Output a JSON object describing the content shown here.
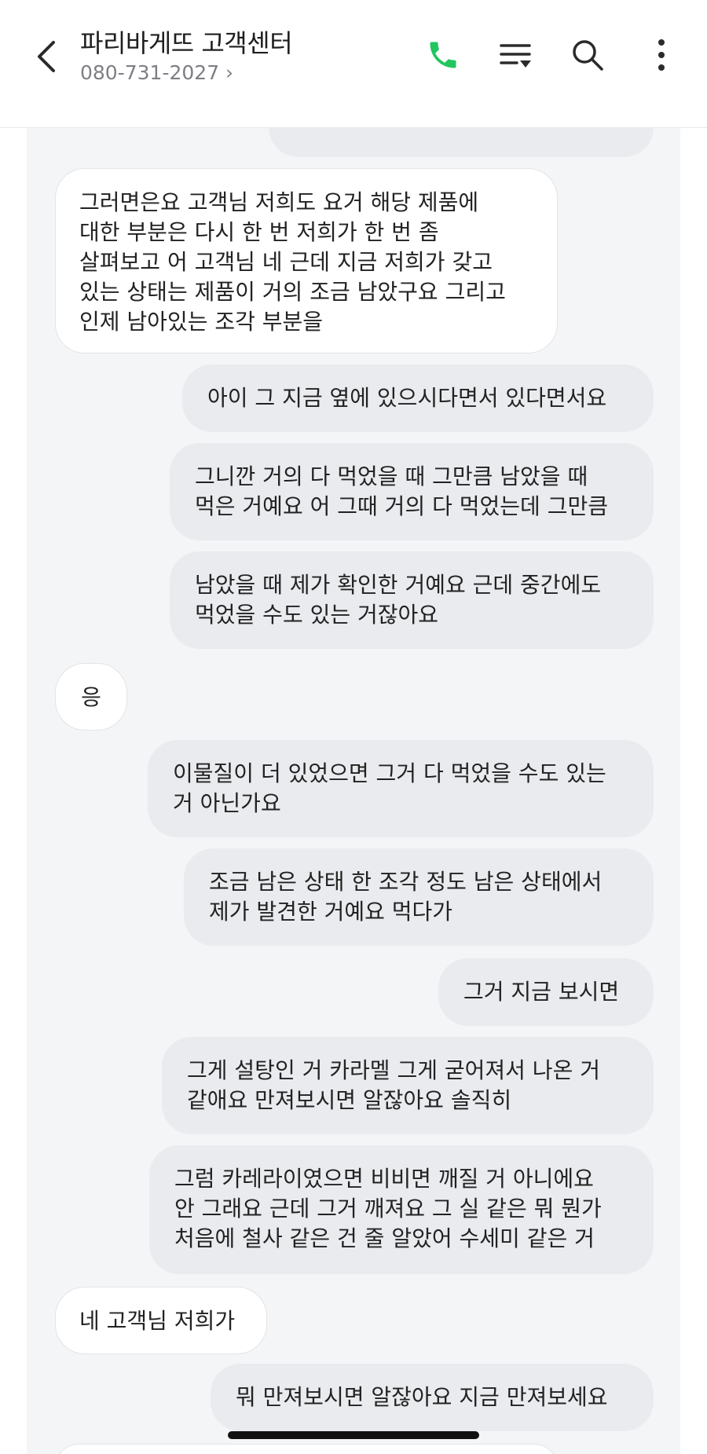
{
  "header": {
    "title": "파리바게뜨 고객센터",
    "phone": "080-731-2027 ›",
    "colors": {
      "call": "#22c55e",
      "text": "#1f1f1f",
      "sub": "#7d7f85"
    }
  },
  "messages": [
    {
      "side": "in",
      "text": "그러면은요 고객님 저희도 요거 해당 제품에\n대한 부분은 다시 한 번 저희가 한 번 좀\n살펴보고 어 고객님 네 근데 지금 저희가 갖고\n있는 상태는 제품이 거의 조금 남았구요 그리고\n인제 남아있는 조각 부분을"
    },
    {
      "side": "out",
      "text": "아이 그 지금 옆에 있으시다면서 있다면서요"
    },
    {
      "side": "out",
      "text": "그니깐 거의 다 먹었을 때 그만큼 남았을 때\n먹은 거예요 어 그때 거의 다 먹었는데 그만큼"
    },
    {
      "side": "out",
      "text": "남았을 때 제가 확인한 거예요 근데 중간에도\n먹었을 수도 있는 거잖아요"
    },
    {
      "side": "in",
      "text": "응"
    },
    {
      "side": "out",
      "text": "이물질이 더 있었으면 그거 다 먹었을 수도 있는\n거 아닌가요"
    },
    {
      "side": "out",
      "text": "조금 남은 상태 한 조각 정도 남은 상태에서\n제가 발견한 거예요 먹다가"
    },
    {
      "side": "out",
      "text": "그거 지금 보시면"
    },
    {
      "side": "out",
      "text": "그게 설탕인 거 카라멜 그게 굳어져서 나온 거\n같애요 만져보시면 알잖아요 솔직히"
    },
    {
      "side": "out",
      "text": "그럼 카레라이였으면 비비면 깨질 거 아니에요\n안 그래요 근데 그거 깨져요 그 실 같은 뭐 뭔가\n처음에 철사 같은 건 줄 알았어 수세미 같은 거"
    },
    {
      "side": "in",
      "text": "네 고객님 저희가"
    },
    {
      "side": "out",
      "text": "뭐 만져보시면 알잖아요 지금 만져보세요"
    }
  ]
}
